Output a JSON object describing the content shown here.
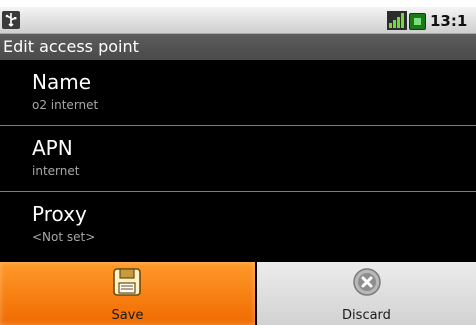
{
  "status_bar": {
    "clock": "13:1",
    "icons": [
      "usb-icon",
      "signal-icon",
      "battery-icon"
    ]
  },
  "title_bar": {
    "title": "Edit access point"
  },
  "list": {
    "items": [
      {
        "title": "Name",
        "value": "o2 internet"
      },
      {
        "title": "APN",
        "value": "internet"
      },
      {
        "title": "Proxy",
        "value": "<Not set>"
      }
    ]
  },
  "actions": {
    "save_label": "Save",
    "discard_label": "Discard",
    "save_icon": "save-disk-icon",
    "discard_icon": "discard-x-icon"
  },
  "colors": {
    "accent": "#f07a10",
    "list_background": "#000000",
    "title_bar": "#555555"
  }
}
